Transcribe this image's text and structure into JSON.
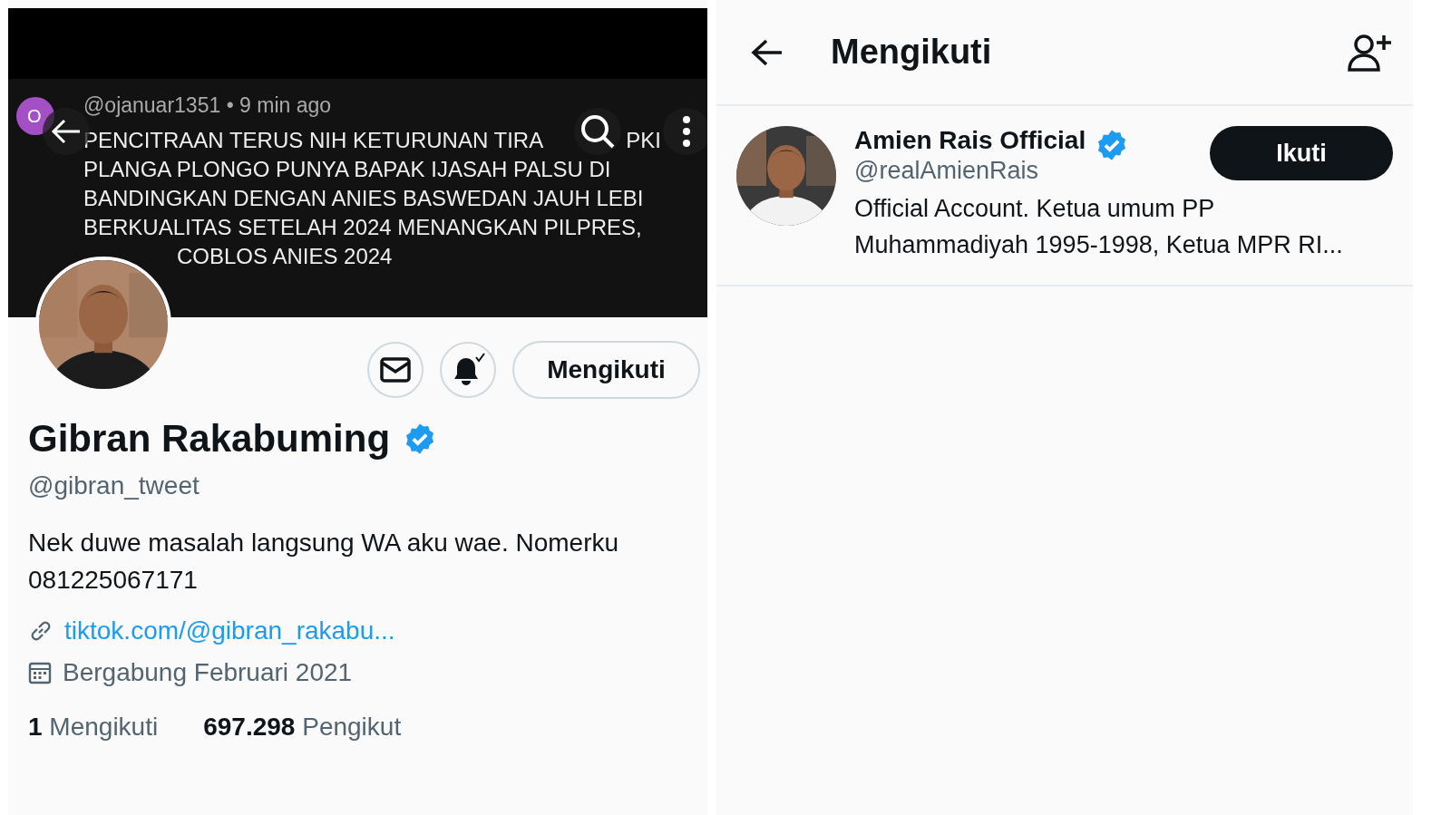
{
  "profile_screen": {
    "banner": {
      "comment": {
        "avatar_letter": "O",
        "meta": "@ojanuar1351 • 9 min ago",
        "first_line_parts": [
          "PENCITRAAN TERUS NIH KETURUNAN TIRA",
          "PKI"
        ],
        "lines": [
          "PLANGA PLONGO PUNYA BAPAK IJASAH PALSU DI",
          "BANDINGKAN DENGAN ANIES BASWEDAN JAUH LEBI",
          "BERKUALITAS SETELAH 2024 MENANGKAN PILPRES,",
          "COBLOS ANIES 2024"
        ]
      }
    },
    "follow_button": "Mengikuti",
    "name": "Gibran Rakabuming",
    "verified": true,
    "handle": "@gibran_tweet",
    "bio": "Nek duwe masalah langsung WA aku wae. Nomerku 081225067171",
    "link": "tiktok.com/@gibran_rakabu...",
    "joined": "Bergabung Februari 2021",
    "stats": [
      "**1** Mengikuti",
      "**697.298** Pengikut"
    ]
  },
  "following_screen": {
    "title": "Mengikuti",
    "users": [
      {
        "name": "Amien Rais Official",
        "verified": true,
        "handle": "@realAmienRais",
        "bio": "Official Account. Ketua umum PP Muhammadiyah 1995-1998, Ketua MPR RI...",
        "button": "Ikuti"
      }
    ]
  }
}
